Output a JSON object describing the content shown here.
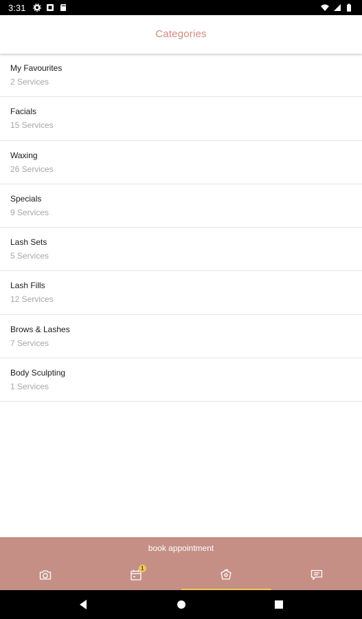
{
  "status_bar": {
    "time": "3:31",
    "left_icons": [
      "settings-icon",
      "media-icon",
      "sd-card-icon"
    ],
    "right_icons": [
      "wifi-icon",
      "signal-icon",
      "battery-icon"
    ]
  },
  "header": {
    "title": "Categories"
  },
  "categories": [
    {
      "name": "My Favourites",
      "count": "2 Services"
    },
    {
      "name": "Facials",
      "count": "15 Services"
    },
    {
      "name": "Waxing",
      "count": "26 Services"
    },
    {
      "name": "Specials",
      "count": "9 Services"
    },
    {
      "name": "Lash Sets",
      "count": "5 Services"
    },
    {
      "name": "Lash Fills",
      "count": "12 Services"
    },
    {
      "name": "Brows & Lashes",
      "count": "7 Services"
    },
    {
      "name": "Body Sculpting",
      "count": "1 Services"
    }
  ],
  "bottom_bar": {
    "book_label": "book appointment",
    "tabs": [
      {
        "icon": "camera-icon",
        "active": false
      },
      {
        "icon": "calendar-icon",
        "active": false,
        "badge": "1"
      },
      {
        "icon": "services-tag-icon",
        "active": true
      },
      {
        "icon": "chat-icon",
        "active": false
      }
    ]
  },
  "system_nav": {
    "buttons": [
      "back-icon",
      "home-icon",
      "recents-icon"
    ]
  },
  "colors": {
    "accent": "#c58f86",
    "title": "#d4897c",
    "active_indicator": "#f0c75a",
    "count_text": "#a6a6a6"
  }
}
